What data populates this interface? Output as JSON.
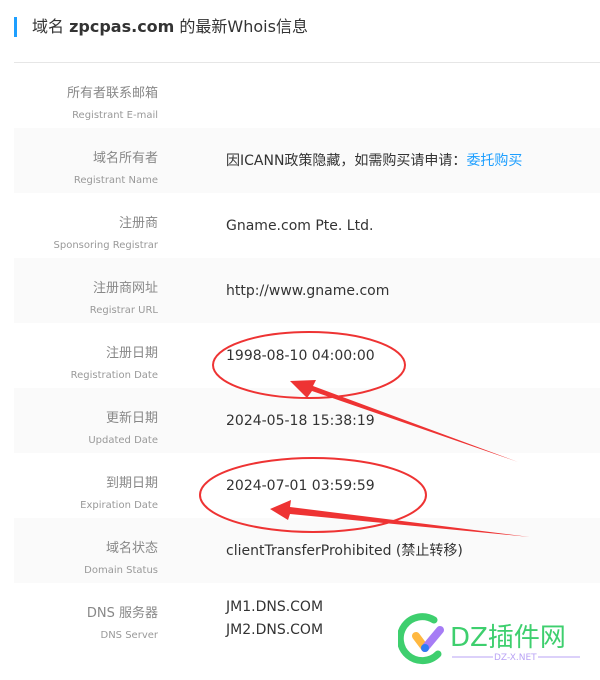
{
  "title": {
    "prefix": "域名 ",
    "domain": "zpcpas.com",
    "suffix": " 的最新Whois信息"
  },
  "rows": [
    {
      "cn": "所有者联系邮箱",
      "en": "Registrant E-mail",
      "value": ""
    },
    {
      "cn": "域名所有者",
      "en": "Registrant Name",
      "value": "因ICANN政策隐藏，如需购买请申请：",
      "link": "委托购买"
    },
    {
      "cn": "注册商",
      "en": "Sponsoring Registrar",
      "value": "Gname.com Pte. Ltd."
    },
    {
      "cn": "注册商网址",
      "en": "Registrar URL",
      "value": "http://www.gname.com"
    },
    {
      "cn": "注册日期",
      "en": "Registration Date",
      "value": "1998-08-10 04:00:00"
    },
    {
      "cn": "更新日期",
      "en": "Updated Date",
      "value": "2024-05-18 15:38:19"
    },
    {
      "cn": "到期日期",
      "en": "Expiration Date",
      "value": "2024-07-01 03:59:59"
    },
    {
      "cn": "域名状态",
      "en": "Domain Status",
      "value": "clientTransferProhibited (禁止转移)"
    },
    {
      "cn": "DNS 服务器",
      "en": "DNS Server",
      "value": "JM1.DNS.COM",
      "value2": "JM2.DNS.COM"
    }
  ],
  "watermark": {
    "text": "DZ插件网",
    "sub": "DZ-X.NET"
  },
  "colors": {
    "accent": "#1e9fff",
    "annotation": "#ee3333",
    "watermark": "#3ecf6e"
  }
}
